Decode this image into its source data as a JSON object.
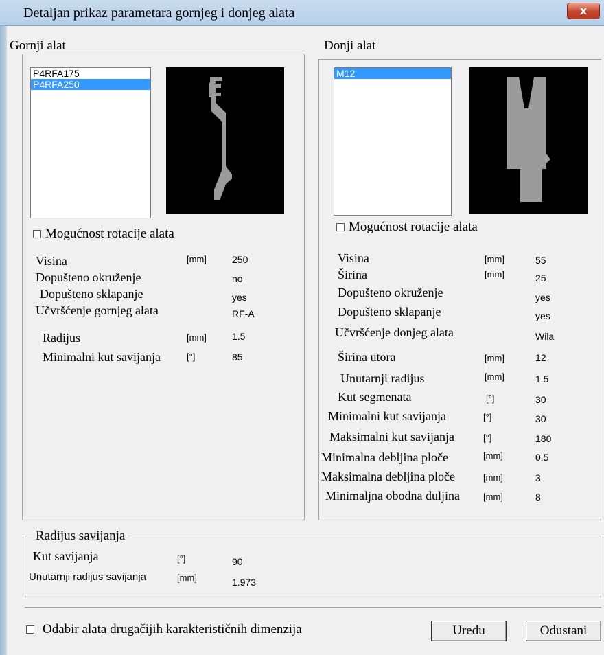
{
  "window": {
    "title": "Detaljan prikaz parametara gornjeg i donjeg alata",
    "close_glyph": "x"
  },
  "upper": {
    "group_label": "Gornji alat",
    "tools": [
      {
        "name": "P4RFA175",
        "selected": false
      },
      {
        "name": "P4RFA250",
        "selected": true
      }
    ],
    "rotation_label": "Mogućnost rotacije alata",
    "rotation_checked": false,
    "params": [
      {
        "label": "Visina",
        "unit": "[mm]",
        "value": "250"
      },
      {
        "label": "Dopušteno okruženje",
        "unit": "",
        "value": "no"
      },
      {
        "label": "Dopušteno sklapanje",
        "unit": "",
        "value": "yes"
      },
      {
        "label": "Učvršćenje gornjeg alata",
        "unit": "",
        "value": "RF-A"
      },
      {
        "label": "Radijus",
        "unit": "[mm]",
        "value": "1.5"
      },
      {
        "label": "Minimalni kut savijanja",
        "unit": "[°]",
        "value": "85"
      }
    ]
  },
  "lower": {
    "group_label": "Donji alat",
    "tools": [
      {
        "name": "M12",
        "selected": true
      }
    ],
    "rotation_label": "Mogućnost rotacije alata",
    "rotation_checked": false,
    "params": [
      {
        "label": "Visina",
        "unit": "[mm]",
        "value": "55"
      },
      {
        "label": "Širina",
        "unit": "[mm]",
        "value": "25"
      },
      {
        "label": "Dopušteno okruženje",
        "unit": "",
        "value": "yes"
      },
      {
        "label": "Dopušteno sklapanje",
        "unit": "",
        "value": "yes"
      },
      {
        "label": "Učvršćenje donjeg alata",
        "unit": "",
        "value": "Wila"
      },
      {
        "label": "Širina utora",
        "unit": "[mm]",
        "value": "12"
      },
      {
        "label": "Unutarnji radijus",
        "unit": "[mm]",
        "value": "1.5"
      },
      {
        "label": "Kut segmenata",
        "unit": "[°]",
        "value": "30"
      },
      {
        "label": "Minimalni kut savijanja",
        "unit": "[°]",
        "value": "30"
      },
      {
        "label": "Maksimalni kut savijanja",
        "unit": "[°]",
        "value": "180"
      },
      {
        "label": "Minimalna debljina ploče",
        "unit": "[mm]",
        "value": "0.5"
      },
      {
        "label": "Maksimalna debljina ploče",
        "unit": "[mm]",
        "value": "3"
      },
      {
        "label": "Minimaljna obodna duljina",
        "unit": "[mm]",
        "value": "8"
      }
    ]
  },
  "bending": {
    "group_label": "Radijus savijanja",
    "angle_label": "Kut savijanja",
    "angle_unit": "[°]",
    "angle_value": "90",
    "inner_radius_label": "Unutarnji radijus savijanja",
    "inner_radius_unit": "[mm]",
    "inner_radius_value": "1.973"
  },
  "footer": {
    "alt_tools_label": "Odabir alata drugačijih karakterističnih dimenzija",
    "alt_tools_checked": false,
    "ok_label": "Uredu",
    "cancel_label": "Odustani"
  }
}
